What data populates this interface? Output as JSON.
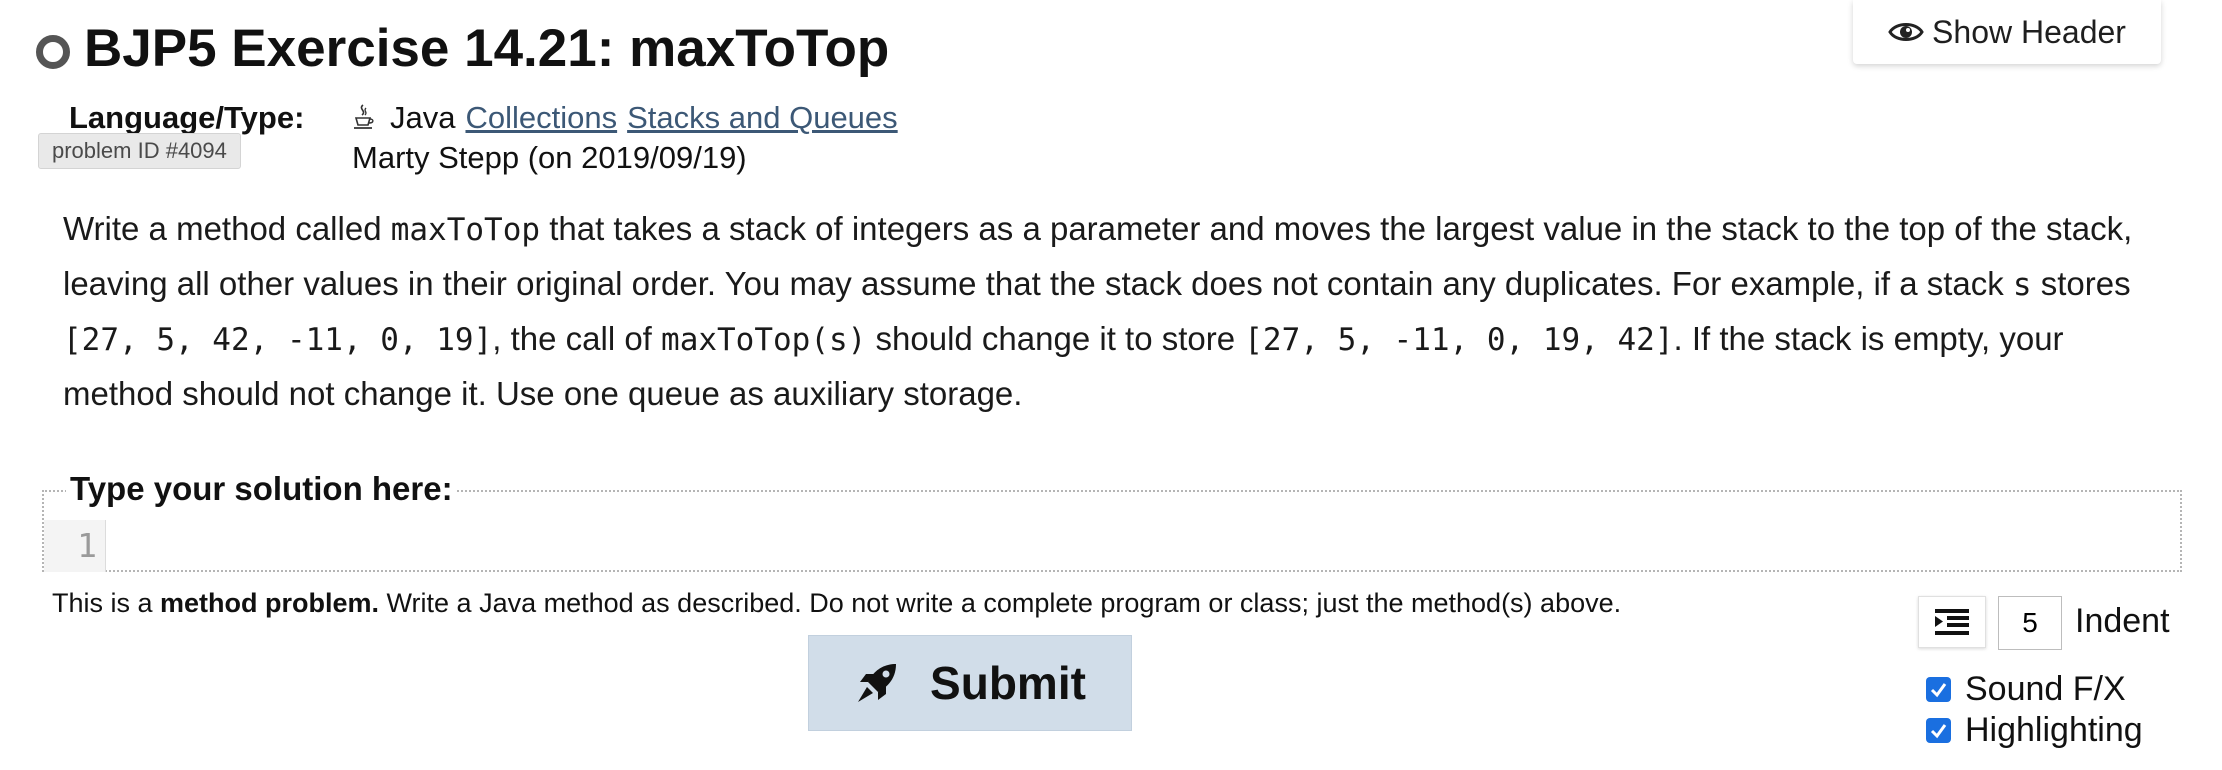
{
  "header": {
    "show_header_label": "Show Header"
  },
  "problem": {
    "title": "BJP5 Exercise 14.21: maxToTop",
    "language_label": "Language/Type:",
    "language": "Java",
    "tags": [
      "Collections",
      "Stacks and Queues"
    ],
    "problem_id": "problem ID #4094",
    "author": "Marty Stepp (on 2019/09/19)"
  },
  "description": {
    "p1": "Write a method called ",
    "code1": "maxToTop",
    "p2": " that takes a stack of integers as a parameter and moves the largest value in the stack to the top of the stack, leaving all other values in their original order. You may assume that the stack does not contain any duplicates. For example, if a stack ",
    "code2": "s",
    "p3": " stores ",
    "code3": "[27, 5, 42, -11, 0, 19]",
    "p4": ", the call of ",
    "code4": "maxToTop(s)",
    "p5": " should change it to store ",
    "code5": "[27, 5, -11, 0, 19, 42]",
    "p6": ". If the stack is empty, your method should not change it. Use one queue as auxiliary storage."
  },
  "solution": {
    "legend": "Type your solution here:",
    "line_number": "1",
    "code_value": ""
  },
  "note": {
    "prefix": "This is a ",
    "bold": "method problem.",
    "suffix": " Write a Java method as described. Do not write a complete program or class; just the method(s) above."
  },
  "actions": {
    "submit_label": "Submit"
  },
  "settings": {
    "indent_value": "5",
    "indent_label": "Indent",
    "sound_label": "Sound F/X",
    "sound_checked": true,
    "highlight_label": "Highlighting",
    "highlight_checked": true
  },
  "colors": {
    "link": "#3c5876",
    "submit_bg": "#d1dde9",
    "checkbox": "#1a6fe0"
  }
}
